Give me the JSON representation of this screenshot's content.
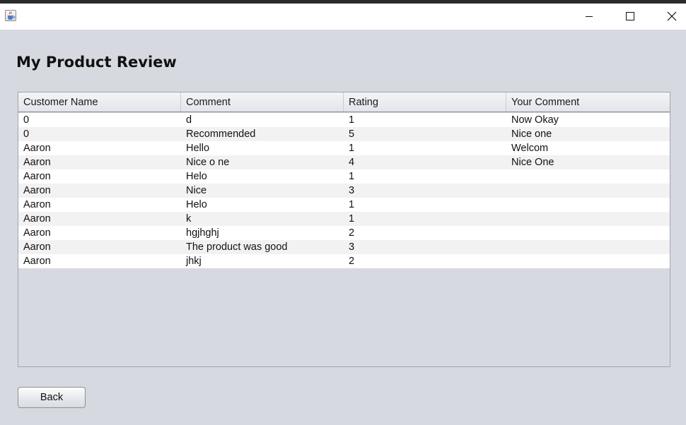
{
  "window": {
    "icon": "java-cup-icon",
    "controls": [
      "minimize-icon",
      "maximize-icon",
      "close-icon"
    ]
  },
  "page": {
    "title": "My Product Review"
  },
  "table": {
    "columns": [
      "Customer Name",
      "Comment",
      "Rating",
      "Your Comment"
    ],
    "rows": [
      [
        "0",
        "d",
        "1",
        "Now Okay"
      ],
      [
        "0",
        "Recommended",
        "5",
        "Nice one"
      ],
      [
        "Aaron",
        "Hello",
        "1",
        "Welcom"
      ],
      [
        "Aaron",
        "Nice o ne",
        "4",
        "Nice One"
      ],
      [
        "Aaron",
        "Helo",
        "1",
        ""
      ],
      [
        "Aaron",
        "Nice",
        "3",
        ""
      ],
      [
        "Aaron",
        "Helo",
        "1",
        ""
      ],
      [
        "Aaron",
        "k",
        "1",
        ""
      ],
      [
        "Aaron",
        "hgjhghj",
        "2",
        ""
      ],
      [
        "Aaron",
        "The product was good",
        "3",
        ""
      ],
      [
        "Aaron",
        "jhkj",
        "2",
        ""
      ]
    ]
  },
  "actions": {
    "back_label": "Back"
  }
}
